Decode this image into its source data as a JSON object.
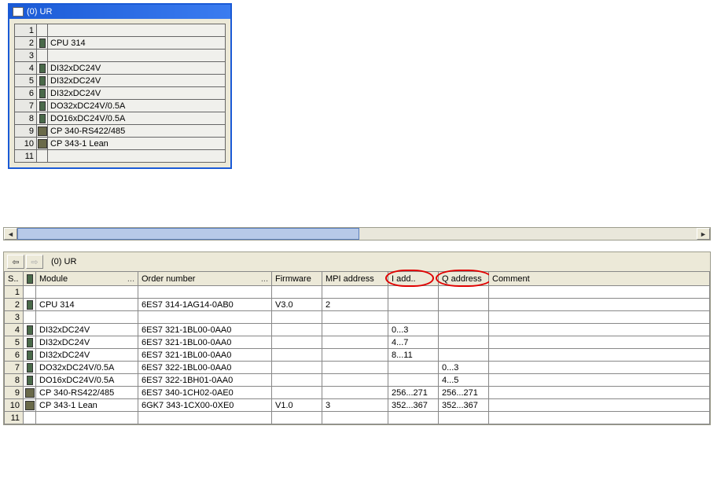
{
  "top_window": {
    "title": "(0) UR",
    "rows": [
      {
        "slot": "1",
        "icon": "",
        "name": ""
      },
      {
        "slot": "2",
        "icon": "mod",
        "name": "CPU 314"
      },
      {
        "slot": "3",
        "icon": "",
        "name": ""
      },
      {
        "slot": "4",
        "icon": "mod",
        "name": "DI32xDC24V"
      },
      {
        "slot": "5",
        "icon": "mod",
        "name": "DI32xDC24V"
      },
      {
        "slot": "6",
        "icon": "mod",
        "name": "DI32xDC24V"
      },
      {
        "slot": "7",
        "icon": "mod",
        "name": "DO32xDC24V/0.5A"
      },
      {
        "slot": "8",
        "icon": "mod",
        "name": "DO16xDC24V/0.5A"
      },
      {
        "slot": "9",
        "icon": "cp",
        "name": "CP 340-RS422/485"
      },
      {
        "slot": "10",
        "icon": "cp",
        "name": "CP 343-1 Lean"
      },
      {
        "slot": "11",
        "icon": "",
        "name": ""
      }
    ]
  },
  "detail": {
    "nav": {
      "back": "←",
      "fwd": "→"
    },
    "path": "(0)   UR",
    "columns": {
      "slot": "S..",
      "module": "Module",
      "order": "Order number",
      "firmware": "Firmware",
      "mpi": "MPI address",
      "iaddr": "I add..",
      "qaddr": "Q address",
      "comment": "Comment",
      "ellipsis": "..."
    },
    "rows": [
      {
        "slot": "1",
        "icon": "",
        "module": "",
        "order": "",
        "fw": "",
        "mpi": "",
        "iaddr": "",
        "qaddr": "",
        "comment": ""
      },
      {
        "slot": "2",
        "icon": "mod",
        "module": "CPU 314",
        "order": "6ES7 314-1AG14-0AB0",
        "fw": "V3.0",
        "mpi": "2",
        "iaddr": "",
        "qaddr": "",
        "comment": ""
      },
      {
        "slot": "3",
        "icon": "",
        "module": "",
        "order": "",
        "fw": "",
        "mpi": "",
        "iaddr": "",
        "qaddr": "",
        "comment": ""
      },
      {
        "slot": "4",
        "icon": "mod",
        "module": "DI32xDC24V",
        "order": "6ES7 321-1BL00-0AA0",
        "fw": "",
        "mpi": "",
        "iaddr": "0...3",
        "qaddr": "",
        "comment": ""
      },
      {
        "slot": "5",
        "icon": "mod",
        "module": "DI32xDC24V",
        "order": "6ES7 321-1BL00-0AA0",
        "fw": "",
        "mpi": "",
        "iaddr": "4...7",
        "qaddr": "",
        "comment": ""
      },
      {
        "slot": "6",
        "icon": "mod",
        "module": "DI32xDC24V",
        "order": "6ES7 321-1BL00-0AA0",
        "fw": "",
        "mpi": "",
        "iaddr": "8...11",
        "qaddr": "",
        "comment": ""
      },
      {
        "slot": "7",
        "icon": "mod",
        "module": "DO32xDC24V/0.5A",
        "order": "6ES7 322-1BL00-0AA0",
        "fw": "",
        "mpi": "",
        "iaddr": "",
        "qaddr": "0...3",
        "comment": ""
      },
      {
        "slot": "8",
        "icon": "mod",
        "module": "DO16xDC24V/0.5A",
        "order": "6ES7 322-1BH01-0AA0",
        "fw": "",
        "mpi": "",
        "iaddr": "",
        "qaddr": "4...5",
        "comment": ""
      },
      {
        "slot": "9",
        "icon": "cp",
        "module": "CP 340-RS422/485",
        "order": "6ES7 340-1CH02-0AE0",
        "fw": "",
        "mpi": "",
        "iaddr": "256...271",
        "qaddr": "256...271",
        "comment": ""
      },
      {
        "slot": "10",
        "icon": "cp",
        "module": "CP 343-1 Lean",
        "order": "6GK7 343-1CX00-0XE0",
        "fw": "V1.0",
        "mpi": "3",
        "iaddr": "352...367",
        "qaddr": "352...367",
        "comment": ""
      },
      {
        "slot": "11",
        "icon": "",
        "module": "",
        "order": "",
        "fw": "",
        "mpi": "",
        "iaddr": "",
        "qaddr": "",
        "comment": ""
      }
    ]
  },
  "scroll": {
    "left_arrow": "◄",
    "right_arrow": "►"
  }
}
